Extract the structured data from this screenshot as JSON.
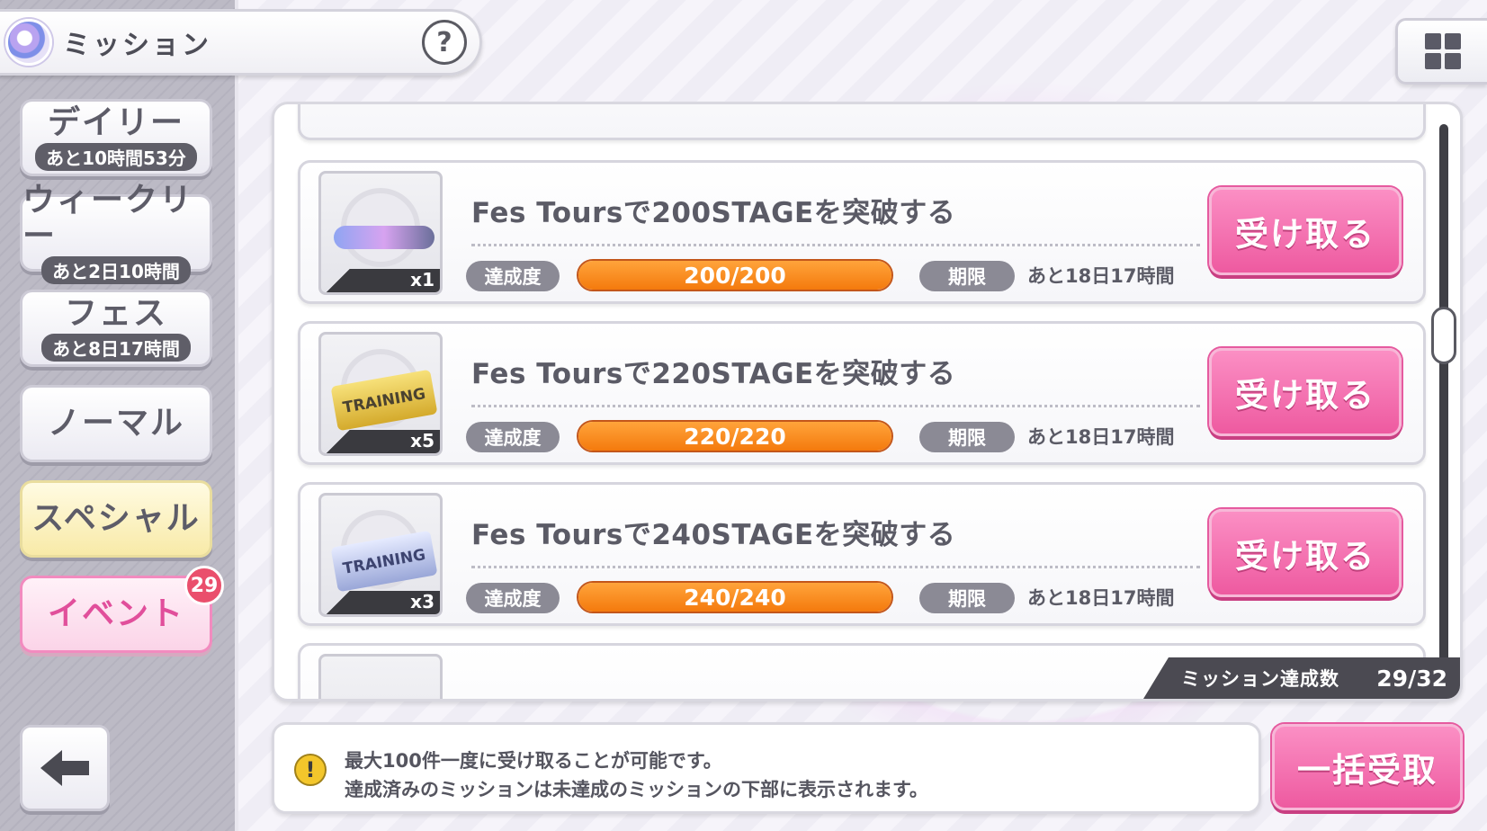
{
  "header": {
    "title": "ミッション",
    "help_label": "?"
  },
  "sidebar": {
    "items": [
      {
        "label": "デイリー",
        "sub": "あと10時間53分"
      },
      {
        "label": "ウィークリー",
        "sub": "あと2日10時間"
      },
      {
        "label": "フェス",
        "sub": "あと8日17時間"
      },
      {
        "label": "ノーマル"
      },
      {
        "label": "スペシャル"
      },
      {
        "label": "イベント",
        "badge": "29"
      }
    ]
  },
  "missions": [
    {
      "reward_label": "",
      "reward_qty": "x1",
      "title": "Fes Toursで200STAGEを突破する",
      "progress_label": "達成度",
      "progress": "200/200",
      "progress_fraction": 1.0,
      "deadline_label": "期限",
      "deadline": "あと18日17時間",
      "claim_label": "受け取る"
    },
    {
      "reward_label": "TRAINING",
      "reward_qty": "x5",
      "title": "Fes Toursで220STAGEを突破する",
      "progress_label": "達成度",
      "progress": "220/220",
      "progress_fraction": 1.0,
      "deadline_label": "期限",
      "deadline": "あと18日17時間",
      "claim_label": "受け取る"
    },
    {
      "reward_label": "TRAINING",
      "reward_qty": "x3",
      "title": "Fes Toursで240STAGEを突破する",
      "progress_label": "達成度",
      "progress": "240/240",
      "progress_fraction": 1.0,
      "deadline_label": "期限",
      "deadline": "あと18日17時間",
      "claim_label": "受け取る"
    }
  ],
  "summary": {
    "label": "ミッション達成数",
    "value": "29/32"
  },
  "notice": {
    "icon": "!",
    "line1": "最大100件一度に受け取ることが可能です。",
    "line2": "達成済みのミッションは未達成のミッションの下部に表示されます。"
  },
  "bulk_claim_label": "一括受取",
  "colors": {
    "accent_pink": "#ee5aa0",
    "progress_orange": "#f47a0d"
  },
  "icons": {
    "menu": "grid-icon",
    "back": "arrow-left-icon",
    "help": "question-icon"
  }
}
